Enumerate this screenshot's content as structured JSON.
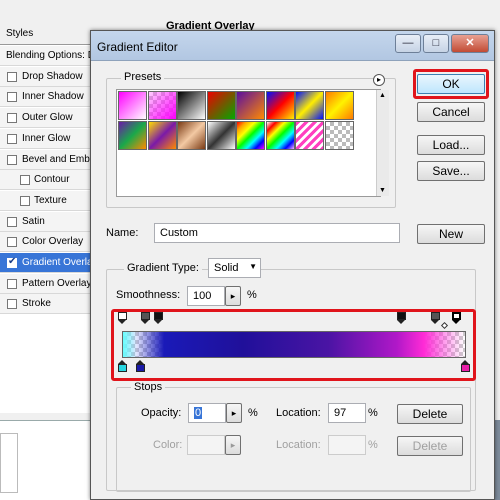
{
  "background_window": {
    "styles_header": "Styles",
    "gradient_overlay_header": "Gradient Overlay",
    "items": [
      {
        "label": "Blending Options: Default",
        "checkbox": false
      },
      {
        "label": "Drop Shadow",
        "checkbox": true
      },
      {
        "label": "Inner Shadow",
        "checkbox": true
      },
      {
        "label": "Outer Glow",
        "checkbox": true
      },
      {
        "label": "Inner Glow",
        "checkbox": true
      },
      {
        "label": "Bevel and Emboss",
        "checkbox": true
      },
      {
        "label": "Contour",
        "checkbox": true,
        "sub": true
      },
      {
        "label": "Texture",
        "checkbox": true,
        "sub": true
      },
      {
        "label": "Satin",
        "checkbox": true
      },
      {
        "label": "Color Overlay",
        "checkbox": true
      },
      {
        "label": "Gradient Overlay",
        "checkbox": true,
        "checked": true,
        "selected": true
      },
      {
        "label": "Pattern Overlay",
        "checkbox": true
      },
      {
        "label": "Stroke",
        "checkbox": true
      }
    ]
  },
  "dialog": {
    "title": "Gradient Editor",
    "window_buttons": {
      "minimize": "—",
      "maximize": "□",
      "close": "✕"
    },
    "presets": {
      "label": "Presets",
      "menu_icon": "▸"
    },
    "buttons": {
      "ok": "OK",
      "cancel": "Cancel",
      "load": "Load...",
      "save": "Save...",
      "new": "New"
    },
    "name": {
      "label": "Name:",
      "value": "Custom"
    },
    "gradient_type": {
      "label": "Gradient Type:",
      "value": "Solid"
    },
    "smoothness": {
      "label": "Smoothness:",
      "value": "100",
      "unit": "%"
    },
    "stops": {
      "label": "Stops",
      "opacity": {
        "label": "Opacity:",
        "value": "0",
        "unit": "%"
      },
      "location_top": {
        "label": "Location:",
        "value": "97",
        "unit": "%"
      },
      "delete_top": "Delete",
      "color": {
        "label": "Color:"
      },
      "location_bottom": {
        "label": "Location:",
        "value": "",
        "unit": "%"
      },
      "delete_bottom": "Delete"
    }
  },
  "highlight_color": "#e0141b",
  "preset_swatches": [
    "magenta-white",
    "transparent-magenta",
    "black-white",
    "red-green",
    "violet-orange",
    "blue-red-yellow",
    "blue-yellow-blue",
    "orange-yellow-orange",
    "violet-green-orange",
    "yellow-violet-orange",
    "copper",
    "chrome",
    "spectrum",
    "transparent-rainbow",
    "transparent-stripes",
    "checker"
  ]
}
